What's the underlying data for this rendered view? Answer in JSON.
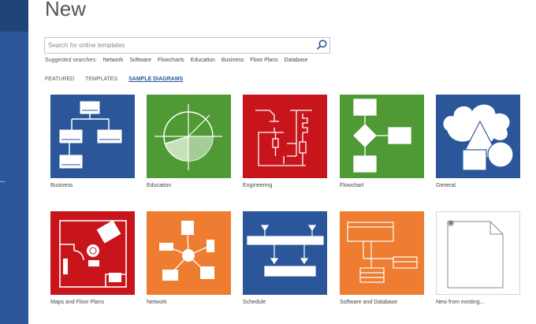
{
  "page": {
    "title": "New"
  },
  "search": {
    "placeholder": "Search for online templates"
  },
  "suggested": {
    "label": "Suggested searches:",
    "items": [
      "Network",
      "Software",
      "Flowcharts",
      "Education",
      "Business",
      "Floor Plans",
      "Database"
    ]
  },
  "tabs": [
    "FEATURED",
    "TEMPLATES",
    "SAMPLE DIAGRAMS"
  ],
  "active_tab": "SAMPLE DIAGRAMS",
  "tiles": [
    {
      "label": "Business",
      "icon": "org-chart-icon",
      "color": "#2b579a"
    },
    {
      "label": "Education",
      "icon": "pie-graph-icon",
      "color": "#4f9a35"
    },
    {
      "label": "Engineering",
      "icon": "circuit-icon",
      "color": "#c8151b"
    },
    {
      "label": "Flowchart",
      "icon": "flowchart-icon",
      "color": "#4f9a35"
    },
    {
      "label": "General",
      "icon": "shapes-icon",
      "color": "#2b579a"
    },
    {
      "label": "Maps and Floor Plans",
      "icon": "floor-plan-icon",
      "color": "#c8151b"
    },
    {
      "label": "Network",
      "icon": "network-icon",
      "color": "#ee7d31"
    },
    {
      "label": "Schedule",
      "icon": "schedule-icon",
      "color": "#2b579a"
    },
    {
      "label": "Software and Database",
      "icon": "database-icon",
      "color": "#ee7d31"
    },
    {
      "label": "New from existing...",
      "icon": "new-document-icon",
      "color": "#ffffff"
    }
  ]
}
